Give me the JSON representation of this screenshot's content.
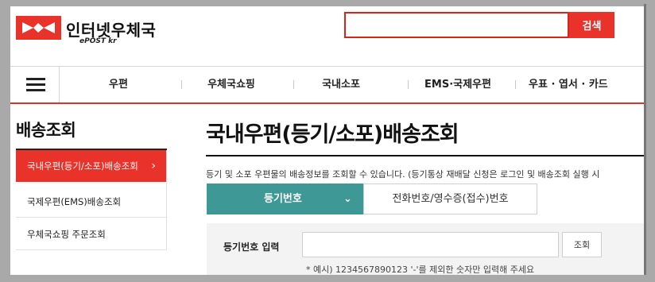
{
  "header": {
    "logo_title": "인터넷우체국",
    "logo_sub": "ePOST kr",
    "search_button": "검색",
    "search_value": ""
  },
  "nav": {
    "menu_icon": "hamburger-icon",
    "items": [
      "우편",
      "우체국쇼핑",
      "국내소포",
      "EMS·국제우편",
      "우표 · 엽서 · 카드"
    ]
  },
  "sidebar": {
    "title": "배송조회",
    "items": [
      {
        "label": "국내우편(등기/소포)배송조회",
        "active": true
      },
      {
        "label": "국제우편(EMS)배송조회",
        "active": false
      },
      {
        "label": "우체국쇼핑 주문조회",
        "active": false
      }
    ],
    "chevron": "›"
  },
  "main": {
    "title": "국내우편(등기/소포)배송조회",
    "description": "등기 및 소포 우편물의 배송정보를 조회할 수 있습니다. (등기통상 재배달 신청은 로그인 및 배송조회 실행 시",
    "tabs": [
      {
        "label": "등기번호",
        "active": true
      },
      {
        "label": "전화번호/영수증(접수)번호",
        "active": false
      }
    ],
    "form": {
      "label": "등기번호 입력",
      "input_value": "",
      "button": "조회",
      "hint": "* 예시) 1234567890123 '-'를 제외한 숫자만 입력해 주세요"
    }
  },
  "colors": {
    "brand_red": "#e8322a",
    "tab_teal": "#3e9895",
    "panel_gray": "#f3f3f3"
  }
}
